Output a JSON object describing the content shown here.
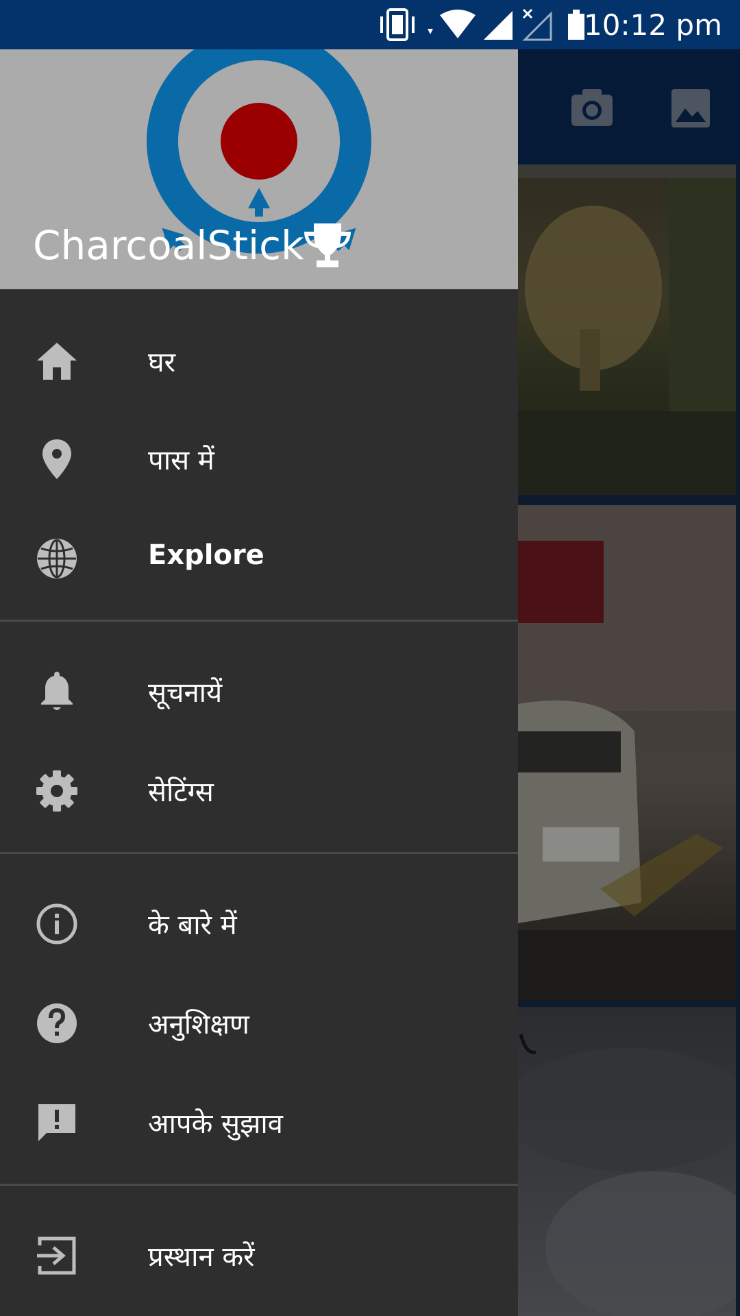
{
  "status_bar": {
    "time": "10:12 pm",
    "icons": [
      "vibrate-icon",
      "wifi-icon",
      "signal-icon",
      "no-signal-icon",
      "battery-icon"
    ]
  },
  "toolbar": {
    "icons": [
      "camera-icon",
      "gallery-icon"
    ]
  },
  "drawer": {
    "username": "CharcoalStick",
    "header_color": "#ababab",
    "background_color": "#2e2e2f",
    "groups": [
      [
        {
          "label": "घर",
          "icon": "home-icon"
        },
        {
          "label": "पास में",
          "icon": "location-pin-icon"
        },
        {
          "label": "Explore",
          "icon": "globe-icon"
        }
      ],
      [
        {
          "label": "सूचनायें",
          "icon": "bell-icon"
        },
        {
          "label": "सेटिंग्स",
          "icon": "gear-icon"
        }
      ],
      [
        {
          "label": "के बारे में",
          "icon": "info-icon"
        },
        {
          "label": "अनुशिक्षण",
          "icon": "help-icon"
        },
        {
          "label": "आपके सुझाव",
          "icon": "feedback-icon"
        }
      ],
      [
        {
          "label": "प्रस्थान करें",
          "icon": "exit-icon"
        }
      ]
    ]
  }
}
